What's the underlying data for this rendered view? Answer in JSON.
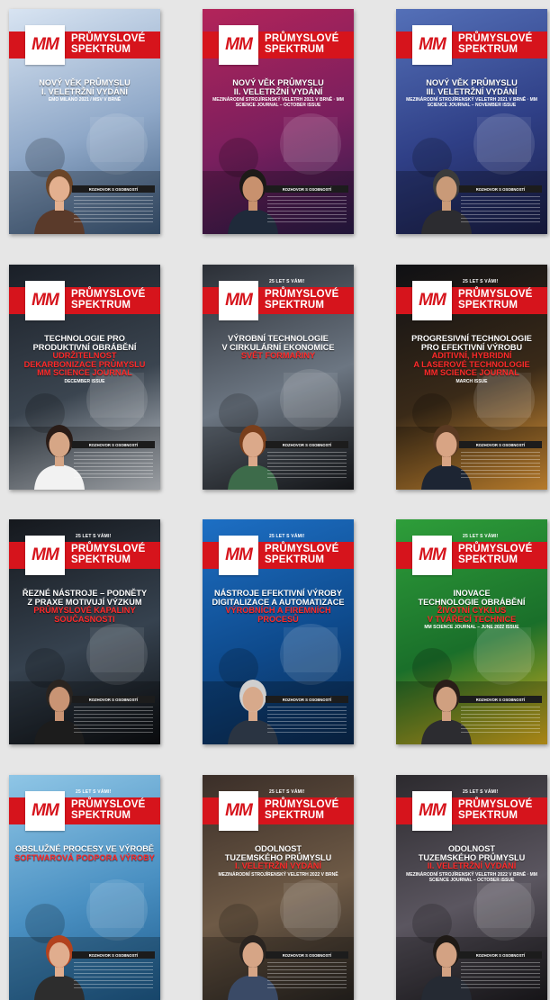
{
  "covers": [
    {
      "tag": "",
      "brand1": "PRŮMYSLOVÉ",
      "brand2": "SPEKTRUM",
      "logo": "MM",
      "lines": [
        "NOVÝ VĚK PRŮMYSLU",
        "I. VELETRŽNÍ VYDÁNÍ",
        "EMO MILANO 2021 / MSV V BRNĚ"
      ],
      "interview": "ROZHOVOR S OSOBNOSTÍ",
      "bg": [
        "#d8e4f2",
        "#8fa8c8",
        "#3f5c7e"
      ],
      "person": {
        "skin": "#e3b08f",
        "hair": "#6b4528",
        "cloth": "#5a3a2a"
      }
    },
    {
      "tag": "",
      "brand1": "PRŮMYSLOVÉ",
      "brand2": "SPEKTRUM",
      "logo": "MM",
      "lines": [
        "NOVÝ VĚK PRŮMYSLU",
        "II. VELETRŽNÍ VYDÁNÍ",
        "MEZINÁRODNÍ STROJÍRENSKÝ VELETRH 2021 V BRNĚ · MM SCIENCE JOURNAL – OCTOBER ISSUE"
      ],
      "interview": "ROZHOVOR S OSOBNOSTÍ",
      "bg": [
        "#b3245a",
        "#7a1f5e",
        "#2b1c4a"
      ],
      "person": {
        "skin": "#c8916e",
        "hair": "#1d1a18",
        "cloth": "#1f2a3a"
      }
    },
    {
      "tag": "",
      "brand1": "PRŮMYSLOVÉ",
      "brand2": "SPEKTRUM",
      "logo": "MM",
      "lines": [
        "NOVÝ VĚK PRŮMYSLU",
        "III. VELETRŽNÍ VYDÁNÍ",
        "MEZINÁRODNÍ STROJÍRENSKÝ VELETRH 2021 V BRNĚ · MM SCIENCE JOURNAL – NOVEMBER ISSUE"
      ],
      "interview": "ROZHOVOR S OSOBNOSTÍ",
      "bg": [
        "#5470b8",
        "#2f3f86",
        "#1b1f4a"
      ],
      "person": {
        "skin": "#c99a78",
        "hair": "#3c3c3c",
        "cloth": "#2c2c30"
      }
    },
    {
      "tag": "",
      "brand1": "PRŮMYSLOVÉ",
      "brand2": "SPEKTRUM",
      "logo": "MM",
      "lines": [
        "TECHNOLOGIE PRO",
        "PRODUKTIVNÍ OBRÁBĚNÍ",
        "UDRŽITELNOST",
        "DEKARBONIZACE PRŮMYSLU",
        "MM SCIENCE JOURNAL",
        "DECEMBER ISSUE"
      ],
      "interview": "ROZHOVOR S OSOBNOSTÍ",
      "bg": [
        "#1a1f27",
        "#3b4550",
        "#cfd4da"
      ],
      "person": {
        "skin": "#d6a686",
        "hair": "#2a1c17",
        "cloth": "#f2f2f2"
      }
    },
    {
      "tag": "25 LET S VÁMI!",
      "brand1": "PRŮMYSLOVÉ",
      "brand2": "SPEKTRUM",
      "logo": "MM",
      "lines": [
        "VÝROBNÍ TECHNOLOGIE",
        "V CIRKULÁRNÍ EKONOMICE",
        "SVĚT FORMAŘINY"
      ],
      "interview": "ROZHOVOR S OSOBNOSTÍ",
      "bg": [
        "#2b2f36",
        "#6c7682",
        "#1a1c20"
      ],
      "person": {
        "skin": "#dba98a",
        "hair": "#7a3f1c",
        "cloth": "#3d6b4a"
      }
    },
    {
      "tag": "25 LET S VÁMI!",
      "brand1": "PRŮMYSLOVÉ",
      "brand2": "SPEKTRUM",
      "logo": "MM",
      "lines": [
        "PROGRESIVNÍ TECHNOLOGIE",
        "PRO EFEKTIVNÍ VÝROBU",
        "ADITIVNÍ, HYBRIDNÍ",
        "A LASEROVÉ TECHNOLOGIE",
        "MM SCIENCE JOURNAL",
        "MARCH ISSUE"
      ],
      "interview": "ROZHOVOR S OSOBNOSTÍ",
      "bg": [
        "#0f1014",
        "#3a2a18",
        "#f2a33a"
      ],
      "person": {
        "skin": "#d8a484",
        "hair": "#5a3a22",
        "cloth": "#1d2533"
      }
    },
    {
      "tag": "25 LET S VÁMI!",
      "brand1": "PRŮMYSLOVÉ",
      "brand2": "SPEKTRUM",
      "logo": "MM",
      "lines": [
        "ŘEZNÉ NÁSTROJE – PODNĚTY",
        "Z PRAXE MOTIVUJÍ VÝZKUM",
        "PRŮMYSLOVÉ KAPALINY",
        "SOUČASNOSTI"
      ],
      "interview": "ROZHOVOR S OSOBNOSTÍ",
      "bg": [
        "#15181d",
        "#36424f",
        "#0d0f12"
      ],
      "person": {
        "skin": "#c99474",
        "hair": "#2a2420",
        "cloth": "#1c1c1c"
      }
    },
    {
      "tag": "25 LET S VÁMI!",
      "brand1": "PRŮMYSLOVÉ",
      "brand2": "SPEKTRUM",
      "logo": "MM",
      "lines": [
        "NÁSTROJE EFEKTIVNÍ VÝROBY",
        "DIGITALIZACE A AUTOMATIZACE",
        "VÝROBNÍCH A FIREMNÍCH",
        "PROCESŮ"
      ],
      "interview": "ROZHOVOR S OSOBNOSTÍ",
      "bg": [
        "#1d6fc4",
        "#0e4a8c",
        "#0b2b52"
      ],
      "person": {
        "skin": "#d7a98b",
        "hair": "#cfcfcf",
        "cloth": "#2a3442"
      }
    },
    {
      "tag": "25 LET S VÁMI!",
      "brand1": "PRŮMYSLOVÉ",
      "brand2": "SPEKTRUM",
      "logo": "MM",
      "lines": [
        "INOVACE",
        "TECHNOLOGIE OBRÁBĚNÍ",
        "ŽIVOTNÍ CYKLUS",
        "V TVÁŘECÍ TECHNICE",
        "MM SCIENCE JOURNAL – JUNE 2022 ISSUE"
      ],
      "interview": "ROZHOVOR S OSOBNOSTÍ",
      "bg": [
        "#2e9e3a",
        "#1a6f2a",
        "#e3b21d"
      ],
      "person": {
        "skin": "#d0a080",
        "hair": "#2a1e18",
        "cloth": "#2c2c30"
      }
    },
    {
      "tag": "25 LET S VÁMI!",
      "brand1": "PRŮMYSLOVÉ",
      "brand2": "SPEKTRUM",
      "logo": "MM",
      "lines": [
        "OBSLUŽNÉ PROCESY VE VÝROBĚ",
        "SOFTWAROVÁ PODPORA VÝROBY"
      ],
      "interview": "ROZHOVOR S OSOBNOSTÍ",
      "bg": [
        "#8fc6e6",
        "#4a90c2",
        "#1f5d8e"
      ],
      "person": {
        "skin": "#e0ad8e",
        "hair": "#b2421e",
        "cloth": "#2d2d2d"
      }
    },
    {
      "tag": "25 LET S VÁMI!",
      "brand1": "PRŮMYSLOVÉ",
      "brand2": "SPEKTRUM",
      "logo": "MM",
      "lines": [
        "ODOLNOST",
        "TUZEMSKÉHO PRŮMYSLU",
        "I. VELETRŽNÍ VYDÁNÍ",
        "MEZINÁRODNÍ STROJÍRENSKÝ VELETRH 2022 V BRNĚ"
      ],
      "interview": "ROZHOVOR S OSOBNOSTÍ",
      "bg": [
        "#3a2e28",
        "#6e5a46",
        "#2a2622"
      ],
      "person": {
        "skin": "#d6a586",
        "hair": "#2a2420",
        "cloth": "#3a4a66"
      }
    },
    {
      "tag": "25 LET S VÁMI!",
      "brand1": "PRŮMYSLOVÉ",
      "brand2": "SPEKTRUM",
      "logo": "MM",
      "lines": [
        "ODOLNOST",
        "TUZEMSKÉHO PRŮMYSLU",
        "II. VELETRŽNÍ VYDÁNÍ",
        "MEZINÁRODNÍ STROJÍRENSKÝ VELETRH 2022 V BRNĚ · MM SCIENCE JOURNAL – OCTOBER ISSUE"
      ],
      "interview": "ROZHOVOR S OSOBNOSTÍ",
      "bg": [
        "#2c2a2e",
        "#5b5660",
        "#1e1c20"
      ],
      "person": {
        "skin": "#d3a283",
        "hair": "#1f1a16",
        "cloth": "#252a33"
      }
    }
  ]
}
